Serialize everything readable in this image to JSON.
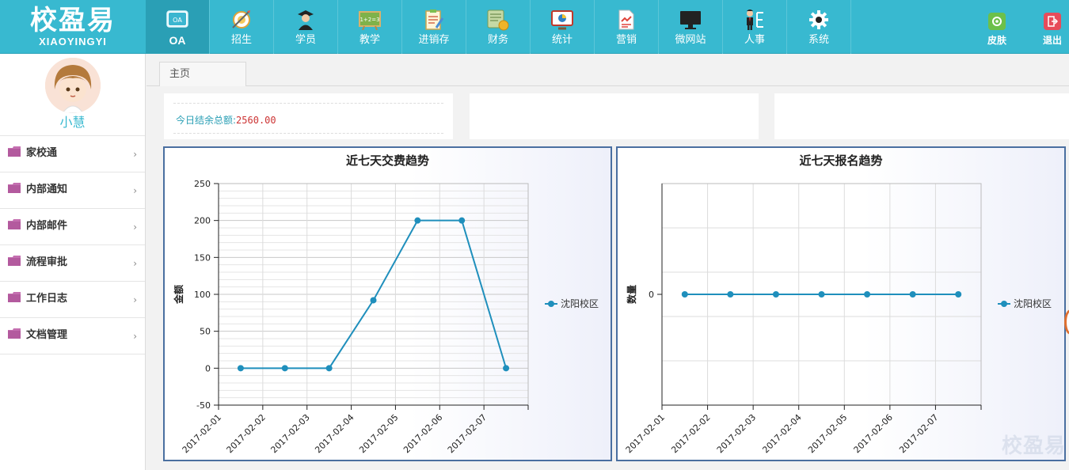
{
  "logo": {
    "main": "校盈易",
    "sub": "XIAOYINGYI"
  },
  "nav": [
    {
      "label": "OA",
      "icon": "oa-icon",
      "active": true
    },
    {
      "label": "招生",
      "icon": "recruit-icon"
    },
    {
      "label": "学员",
      "icon": "student-icon"
    },
    {
      "label": "教学",
      "icon": "teaching-icon"
    },
    {
      "label": "进销存",
      "icon": "inventory-icon"
    },
    {
      "label": "财务",
      "icon": "finance-icon"
    },
    {
      "label": "统计",
      "icon": "statistics-icon"
    },
    {
      "label": "营销",
      "icon": "marketing-icon"
    },
    {
      "label": "微网站",
      "icon": "microsite-icon"
    },
    {
      "label": "人事",
      "icon": "hr-icon"
    },
    {
      "label": "系统",
      "icon": "system-gear-icon"
    }
  ],
  "top_right": {
    "skin": "皮肤",
    "logout": "退出"
  },
  "user": {
    "name": "小慧"
  },
  "sidebar": {
    "items": [
      {
        "label": "家校通"
      },
      {
        "label": "内部通知"
      },
      {
        "label": "内部邮件"
      },
      {
        "label": "流程审批"
      },
      {
        "label": "工作日志"
      },
      {
        "label": "文档管理"
      }
    ]
  },
  "tabs": {
    "home": "主页"
  },
  "summary": {
    "balance_label": "今日结余总额:",
    "balance_value": "2560.00"
  },
  "colors": {
    "brand": "#38b9d0",
    "series": "#1f8fbc",
    "panel_border": "#4a6fa0"
  },
  "chart_data": [
    {
      "type": "line",
      "title": "近七天交费趋势",
      "ylabel": "金额",
      "xlabel": "",
      "categories": [
        "2017-02-01",
        "2017-02-02",
        "2017-02-03",
        "2017-02-04",
        "2017-02-05",
        "2017-02-06",
        "2017-02-07"
      ],
      "series": [
        {
          "name": "沈阳校区",
          "values": [
            0,
            0,
            0,
            92,
            200,
            200,
            0
          ]
        }
      ],
      "ylim": [
        -50,
        250
      ],
      "yticks": [
        -50,
        0,
        50,
        100,
        150,
        200,
        250
      ],
      "grid": true,
      "legend": "right"
    },
    {
      "type": "line",
      "title": "近七天报名趋势",
      "ylabel": "数量",
      "xlabel": "",
      "categories": [
        "2017-02-01",
        "2017-02-02",
        "2017-02-03",
        "2017-02-04",
        "2017-02-05",
        "2017-02-06",
        "2017-02-07"
      ],
      "series": [
        {
          "name": "沈阳校区",
          "values": [
            0,
            0,
            0,
            0,
            0,
            0,
            0
          ]
        }
      ],
      "yticks": [
        0
      ],
      "grid": true,
      "legend": "right"
    }
  ],
  "watermark": {
    "text": "校盈易"
  }
}
